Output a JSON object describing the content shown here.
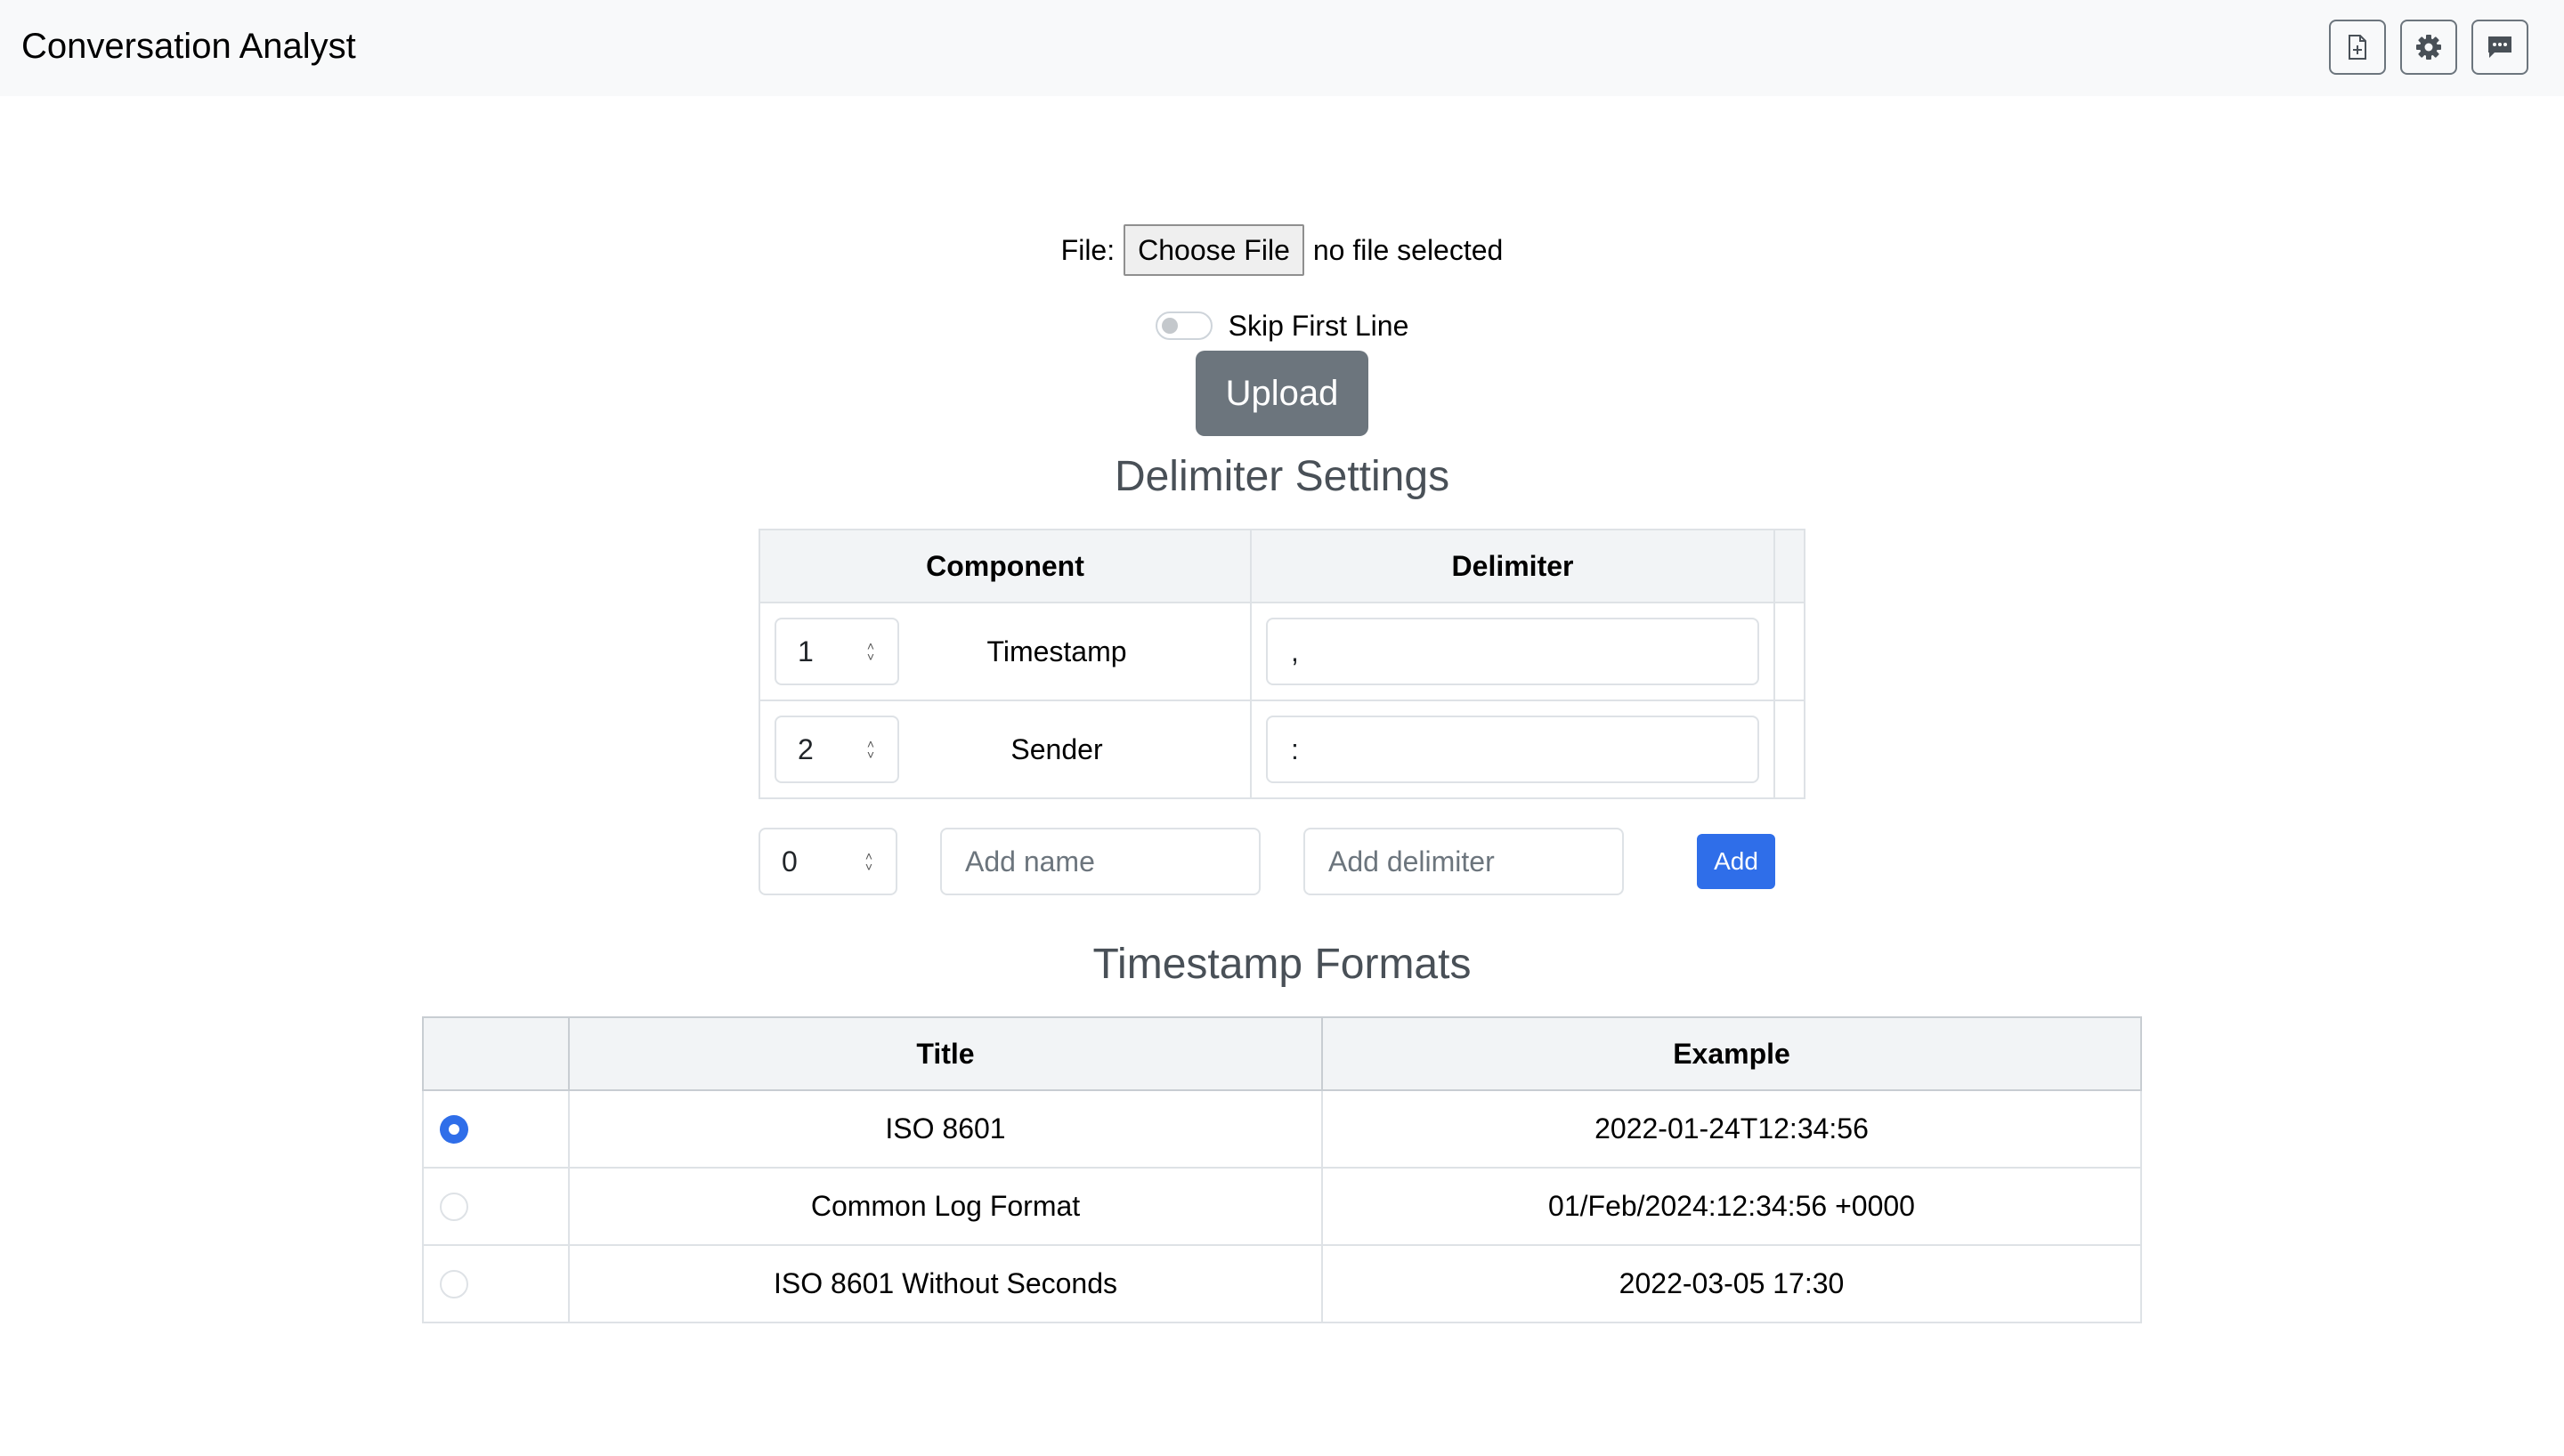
{
  "header": {
    "title": "Conversation Analyst",
    "buttons": [
      {
        "icon": "file-plus-icon"
      },
      {
        "icon": "gear-icon"
      },
      {
        "icon": "chat-dots-icon"
      }
    ]
  },
  "file": {
    "label": "File:",
    "choose_label": "Choose File",
    "status": "no file selected"
  },
  "skip_first_line": {
    "label": "Skip First Line",
    "checked": false
  },
  "upload_label": "Upload",
  "delimiter_settings": {
    "title": "Delimiter Settings",
    "headers": [
      "Component",
      "Delimiter"
    ],
    "rows": [
      {
        "order": "1",
        "component": "Timestamp",
        "delimiter": ","
      },
      {
        "order": "2",
        "component": "Sender",
        "delimiter": ":"
      }
    ],
    "add": {
      "order": "0",
      "name_placeholder": "Add name",
      "delimiter_placeholder": "Add delimiter",
      "button_label": "Add"
    }
  },
  "timestamp_formats": {
    "title": "Timestamp Formats",
    "headers": [
      "",
      "Title",
      "Example"
    ],
    "rows": [
      {
        "title": "ISO 8601",
        "example": "2022-01-24T12:34:56",
        "selected": true
      },
      {
        "title": "Common Log Format",
        "example": "01/Feb/2024:12:34:56 +0000",
        "selected": false
      },
      {
        "title": "ISO 8601 Without Seconds",
        "example": "2022-03-05 17:30",
        "selected": false
      }
    ]
  },
  "colors": {
    "primary": "#2f6ee9",
    "secondary": "#6c757d",
    "navbar_bg": "#f8f9fa"
  }
}
